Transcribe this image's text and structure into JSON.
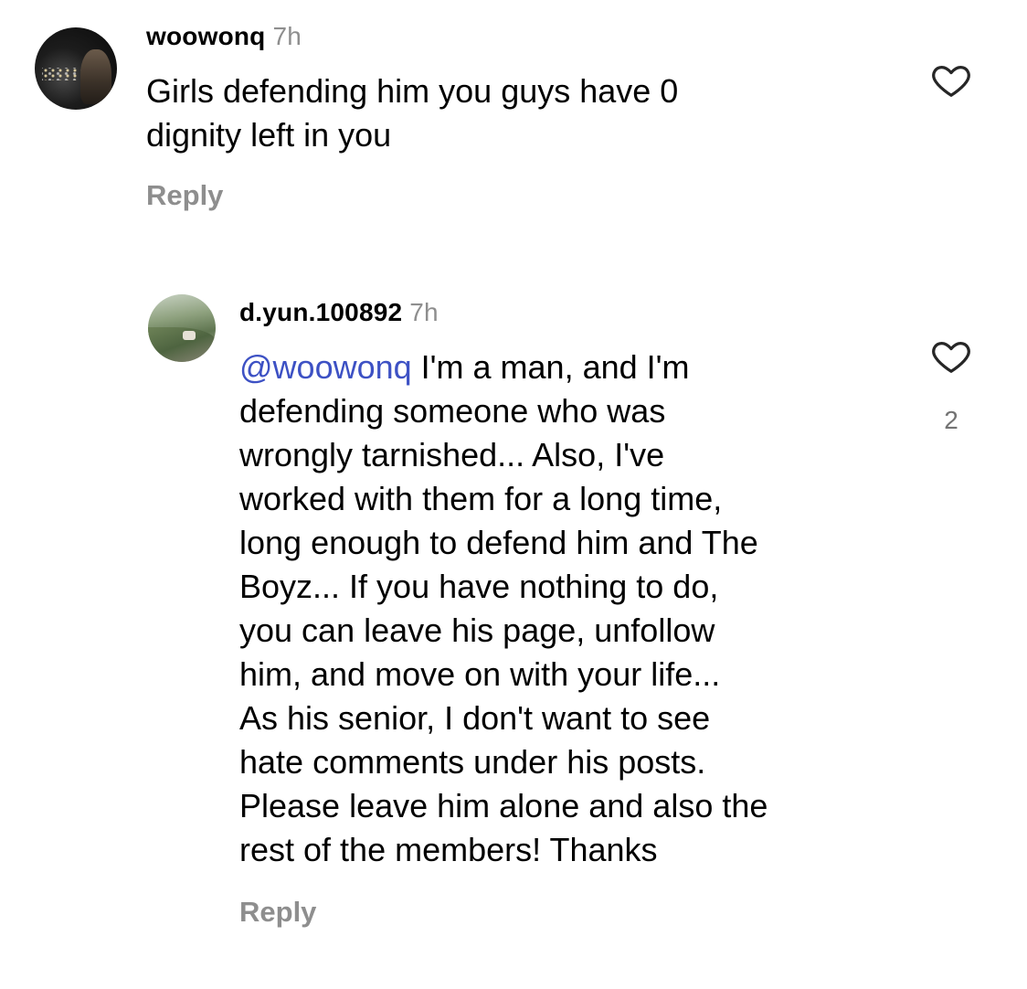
{
  "comments": [
    {
      "username": "woowonq",
      "time": "7h",
      "text": "Girls defending him you guys have 0\ndignity left in you",
      "reply_label": "Reply",
      "likes": ""
    },
    {
      "username": "d.yun.100892",
      "time": "7h",
      "mention": "@woowonq",
      "text": " I'm a man, and I'm\ndefending someone who was\nwrongly tarnished... Also, I've\nworked with them for a long time,\nlong enough to defend him and The\nBoyz... If you have nothing to do,\nyou can leave his page, unfollow\nhim, and move on with your life...\nAs his senior, I don't want to see\nhate comments under his posts.\nPlease leave him alone and also the\nrest of the members! Thanks",
      "reply_label": "Reply",
      "likes": "2"
    }
  ],
  "icons": {
    "like": "heart-outline-icon"
  },
  "colors": {
    "mention": "#3d51c4",
    "muted": "#8e8e8e",
    "text": "#000000",
    "background": "#ffffff"
  }
}
